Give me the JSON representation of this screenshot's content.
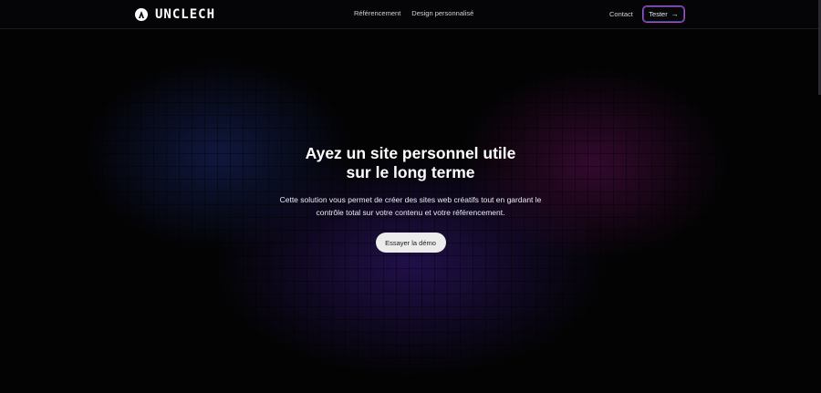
{
  "header": {
    "logo_text": "UNCLECH",
    "nav": [
      {
        "label": "Référencement"
      },
      {
        "label": "Design personnalisé"
      }
    ],
    "contact_label": "Contact",
    "cta_label": "Tester",
    "cta_icon": "arrow-right-icon"
  },
  "hero": {
    "title_line1": "Ayez un site personnel utile",
    "title_line2": "sur le long terme",
    "subtitle_line1": "Cette solution vous permet de créer des sites web créatifs tout en gardant le",
    "subtitle_line2": "contrôle total sur votre contenu et votre référencement.",
    "cta_label": "Essayer la démo"
  },
  "colors": {
    "background": "#030304",
    "glow_blue": "#1a286e",
    "glow_magenta": "#5a0e50",
    "glow_purple": "#30166e",
    "button_bg": "#ececec",
    "tester_border": "#c040c8"
  }
}
